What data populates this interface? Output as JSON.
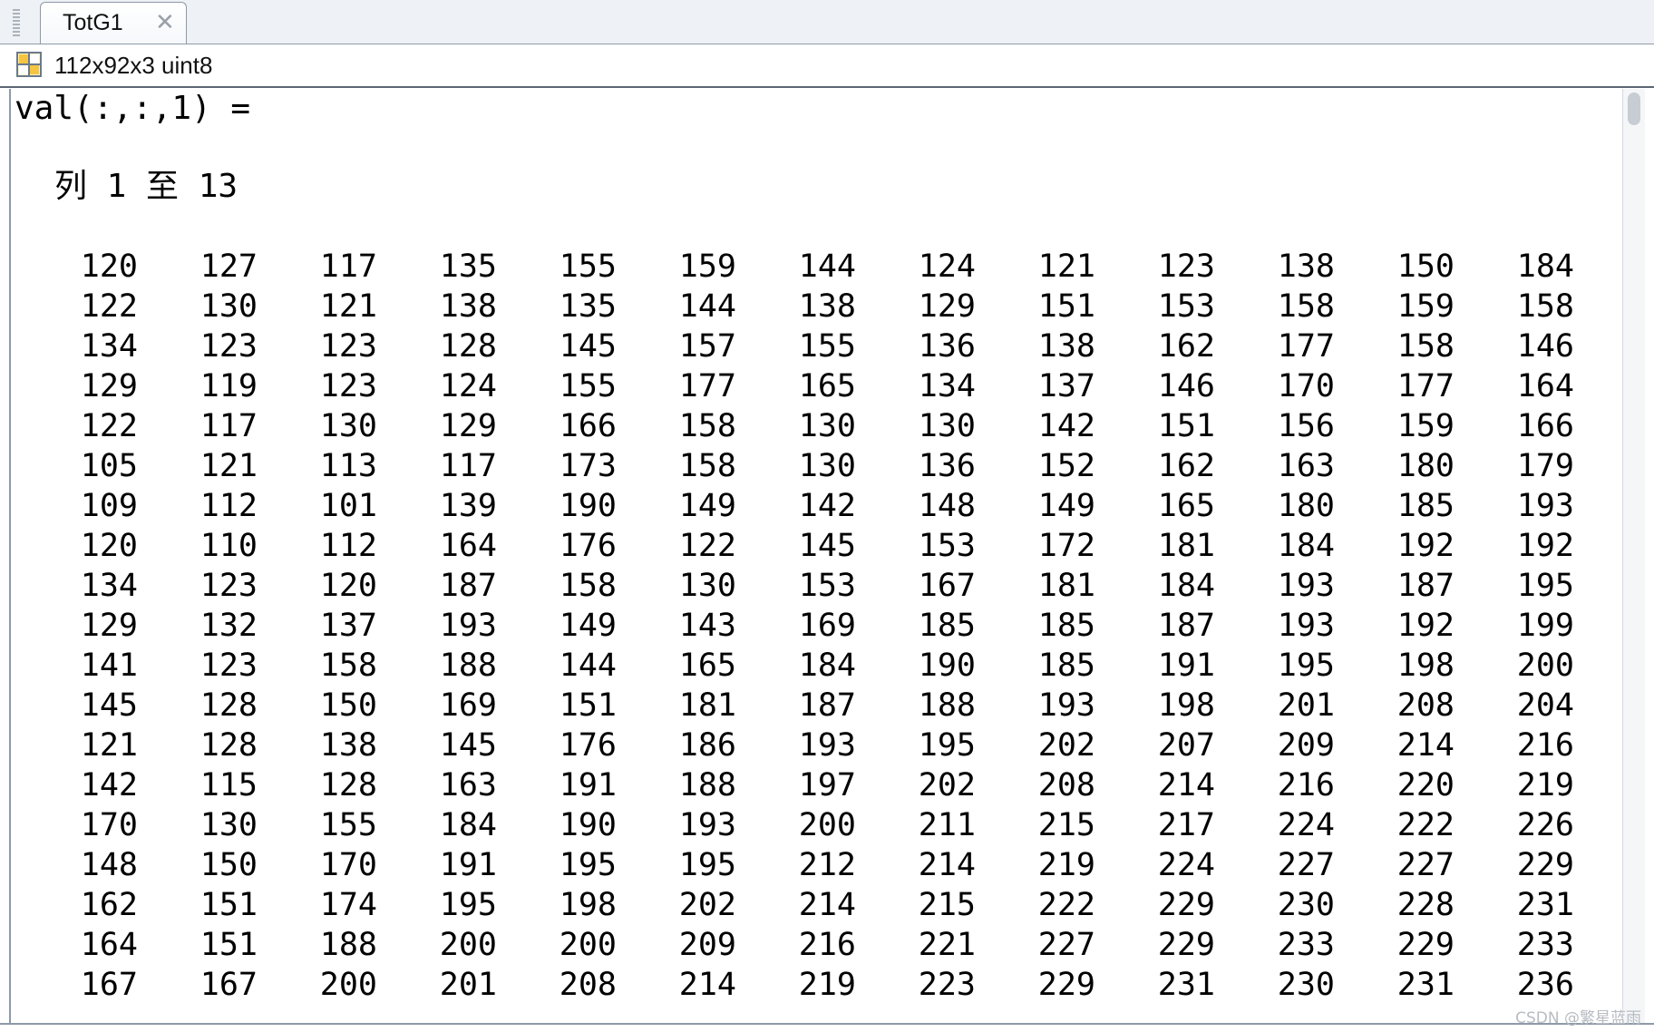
{
  "tab": {
    "title": "TotG1",
    "close_glyph": "✕"
  },
  "variable": {
    "icon": "matrix-grid-icon",
    "info": "112x92x3 uint8"
  },
  "output": {
    "header": "val(:,:,1) =",
    "column_range": "列 1 至 13",
    "rows": [
      [
        "120",
        "127",
        "117",
        "135",
        "155",
        "159",
        "144",
        "124",
        "121",
        "123",
        "138",
        "150",
        "184"
      ],
      [
        "122",
        "130",
        "121",
        "138",
        "135",
        "144",
        "138",
        "129",
        "151",
        "153",
        "158",
        "159",
        "158"
      ],
      [
        "134",
        "123",
        "123",
        "128",
        "145",
        "157",
        "155",
        "136",
        "138",
        "162",
        "177",
        "158",
        "146"
      ],
      [
        "129",
        "119",
        "123",
        "124",
        "155",
        "177",
        "165",
        "134",
        "137",
        "146",
        "170",
        "177",
        "164"
      ],
      [
        "122",
        "117",
        "130",
        "129",
        "166",
        "158",
        "130",
        "130",
        "142",
        "151",
        "156",
        "159",
        "166"
      ],
      [
        "105",
        "121",
        "113",
        "117",
        "173",
        "158",
        "130",
        "136",
        "152",
        "162",
        "163",
        "180",
        "179"
      ],
      [
        "109",
        "112",
        "101",
        "139",
        "190",
        "149",
        "142",
        "148",
        "149",
        "165",
        "180",
        "185",
        "193"
      ],
      [
        "120",
        "110",
        "112",
        "164",
        "176",
        "122",
        "145",
        "153",
        "172",
        "181",
        "184",
        "192",
        "192"
      ],
      [
        "134",
        "123",
        "120",
        "187",
        "158",
        "130",
        "153",
        "167",
        "181",
        "184",
        "193",
        "187",
        "195"
      ],
      [
        "129",
        "132",
        "137",
        "193",
        "149",
        "143",
        "169",
        "185",
        "185",
        "187",
        "193",
        "192",
        "199"
      ],
      [
        "141",
        "123",
        "158",
        "188",
        "144",
        "165",
        "184",
        "190",
        "185",
        "191",
        "195",
        "198",
        "200"
      ],
      [
        "145",
        "128",
        "150",
        "169",
        "151",
        "181",
        "187",
        "188",
        "193",
        "198",
        "201",
        "208",
        "204"
      ],
      [
        "121",
        "128",
        "138",
        "145",
        "176",
        "186",
        "193",
        "195",
        "202",
        "207",
        "209",
        "214",
        "216"
      ],
      [
        "142",
        "115",
        "128",
        "163",
        "191",
        "188",
        "197",
        "202",
        "208",
        "214",
        "216",
        "220",
        "219"
      ],
      [
        "170",
        "130",
        "155",
        "184",
        "190",
        "193",
        "200",
        "211",
        "215",
        "217",
        "224",
        "222",
        "226"
      ],
      [
        "148",
        "150",
        "170",
        "191",
        "195",
        "195",
        "212",
        "214",
        "219",
        "224",
        "227",
        "227",
        "229"
      ],
      [
        "162",
        "151",
        "174",
        "195",
        "198",
        "202",
        "214",
        "215",
        "222",
        "229",
        "230",
        "228",
        "231"
      ],
      [
        "164",
        "151",
        "188",
        "200",
        "200",
        "209",
        "216",
        "221",
        "227",
        "229",
        "233",
        "229",
        "233"
      ],
      [
        "167",
        "167",
        "200",
        "201",
        "208",
        "214",
        "219",
        "223",
        "229",
        "231",
        "230",
        "231",
        "236"
      ]
    ]
  },
  "watermark": "CSDN @繁星蓝雨",
  "colors": {
    "tab_border": "#8e9aa8",
    "background": "#ffffff",
    "text": "#000000"
  }
}
